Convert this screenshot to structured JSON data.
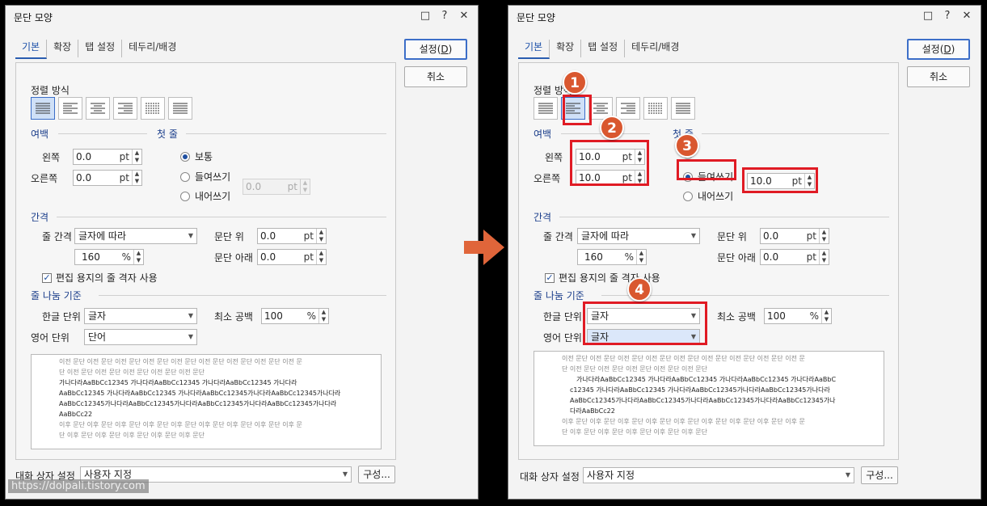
{
  "dialog_title": "문단 모양",
  "titlebar_icons": {
    "help_box": "□",
    "help": "?",
    "close": "✕"
  },
  "tabs": [
    "기본",
    "확장",
    "탭 설정",
    "테두리/배경"
  ],
  "buttons": {
    "ok_text": "설정",
    "ok_key": "D",
    "cancel": "취소",
    "compose": "구성..."
  },
  "sections": {
    "align": "정렬 방식",
    "margin": "여백",
    "first_line": "첫 줄",
    "spacing": "간격",
    "break": "줄 나눔 기준"
  },
  "align_icons": [
    "justify-icon",
    "align-left-icon",
    "align-center-icon",
    "align-right-icon",
    "distribute-icon",
    "divide-icon"
  ],
  "labels": {
    "left": "왼쪽",
    "right": "오른쪽",
    "line_spacing": "줄 간격",
    "para_above": "문단 위",
    "para_below": "문단 아래",
    "grid_check": "편집 용지의 줄 격자 사용",
    "korean_unit": "한글 단위",
    "english_unit": "영어 단위",
    "min_space": "최소 공백",
    "dialog_setting": "대화 상자 설정"
  },
  "radio": {
    "normal": "보통",
    "indent": "들여쓰기",
    "outdent": "내어쓰기"
  },
  "units": {
    "pt": "pt",
    "pct": "%"
  },
  "left_dialog": {
    "margin_left": "0.0",
    "margin_right": "0.0",
    "first_line_value": "0.0",
    "line_spacing_type": "글자에 따라",
    "line_spacing_value": "160",
    "para_above": "0.0",
    "para_below": "0.0",
    "min_space": "100",
    "korean_unit": "글자",
    "english_unit": "단어",
    "dialog_setting": "사용자 지정",
    "selected_radio": "normal"
  },
  "right_dialog": {
    "margin_left": "10.0",
    "margin_right": "10.0",
    "first_line_value": "10.0",
    "line_spacing_type": "글자에 따라",
    "line_spacing_value": "160",
    "para_above": "0.0",
    "para_below": "0.0",
    "min_space": "100",
    "korean_unit": "글자",
    "english_unit": "글자",
    "dialog_setting": "사용자 지정",
    "selected_radio": "indent"
  },
  "preview_left": {
    "before": [
      "이전 문단 이전 문단 이전 문단 이전 문단 이전 문단 이전 문단 이전 문단 이전 문단 이전 문",
      "단 이전 문단 이전 문단 이전 문단 이전 문단 이전 문단"
    ],
    "body": [
      "가나다라AaBbCc12345     가나다라AaBbCc12345     가나다라AaBbCc12345     가나다라",
      "AaBbCc12345  가나다라AaBbCc12345  가나다라AaBbCc12345가나다라AaBbCc12345가나다라",
      "AaBbCc12345가나다라AaBbCc12345가나다라AaBbCc12345가나다라AaBbCc12345가나다라",
      "AaBbCc22"
    ],
    "after": [
      "이후 문단 이후 문단 이후 문단 이후 문단 이후 문단 이후 문단 이후 문단 이후 문단 이후 문",
      "단 이후 문단 이후 문단 이후 문단 이후 문단 이후 문단"
    ]
  },
  "preview_right": {
    "before": [
      "이전 문단 이전 문단 이전 문단 이전 문단 이전 문단 이전 문단 이전 문단 이전 문단 이전 문",
      "단 이전 문단 이전 문단 이전 문단 이전 문단 이전 문단"
    ],
    "body": [
      "가나다라AaBbCc12345 가나다라AaBbCc12345 가나다라AaBbCc12345 가나다라AaBbC",
      "c12345 가나다라AaBbCc12345 가나다라AaBbCc12345가나다라AaBbCc12345가나다라",
      "AaBbCc12345가나다라AaBbCc12345가나다라AaBbCc12345가나다라AaBbCc12345가나",
      "다라AaBbCc22"
    ],
    "after": [
      "이후 문단 이후 문단 이후 문단 이후 문단 이후 문단 이후 문단 이후 문단 이후 문단 이후 문",
      "단 이후 문단 이후 문단 이후 문단 이후 문단 이후 문단"
    ]
  },
  "badges": [
    "1",
    "2",
    "3",
    "4"
  ],
  "watermark": "https://dolpali.tistory.com",
  "colors": {
    "accent": "#2a5db0",
    "highlight": "#e01b24",
    "badge": "#d9572f",
    "arrow": "#e0653a"
  }
}
